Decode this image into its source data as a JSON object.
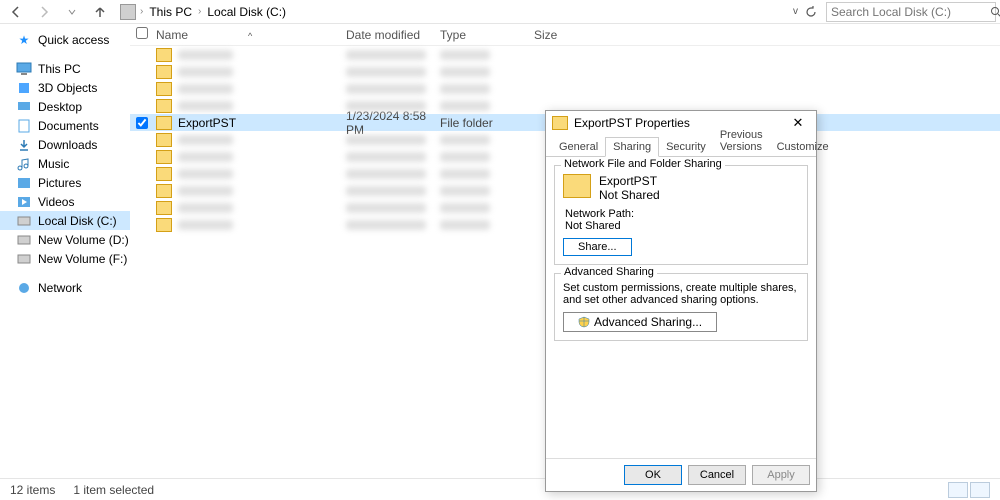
{
  "breadcrumb": {
    "root": "This PC",
    "path": "Local Disk (C:)"
  },
  "search": {
    "placeholder": "Search Local Disk (C:)"
  },
  "sidebar": {
    "quick": {
      "label": "Quick access"
    },
    "thispc": {
      "label": "This PC",
      "items": [
        {
          "label": "3D Objects"
        },
        {
          "label": "Desktop"
        },
        {
          "label": "Documents"
        },
        {
          "label": "Downloads"
        },
        {
          "label": "Music"
        },
        {
          "label": "Pictures"
        },
        {
          "label": "Videos"
        },
        {
          "label": "Local Disk (C:)"
        },
        {
          "label": "New Volume (D:)"
        },
        {
          "label": "New Volume (F:)"
        }
      ]
    },
    "network": {
      "label": "Network"
    }
  },
  "columns": {
    "name": "Name",
    "date": "Date modified",
    "type": "Type",
    "size": "Size"
  },
  "rows": {
    "selected": {
      "name": "ExportPST",
      "date": "1/23/2024 8:58 PM",
      "type": "File folder"
    }
  },
  "statusbar": {
    "count": "12 items",
    "selected": "1 item selected"
  },
  "dialog": {
    "title": "ExportPST Properties",
    "tabs": {
      "general": "General",
      "sharing": "Sharing",
      "security": "Security",
      "previous": "Previous Versions",
      "customize": "Customize"
    },
    "sharing": {
      "group_label": "Network File and Folder Sharing",
      "folder_name": "ExportPST",
      "status": "Not Shared",
      "path_label": "Network Path:",
      "path_value": "Not Shared",
      "share_btn": "Share...",
      "adv_group_label": "Advanced Sharing",
      "adv_desc": "Set custom permissions, create multiple shares, and set other advanced sharing options.",
      "adv_btn": "Advanced Sharing..."
    },
    "buttons": {
      "ok": "OK",
      "cancel": "Cancel",
      "apply": "Apply"
    }
  }
}
